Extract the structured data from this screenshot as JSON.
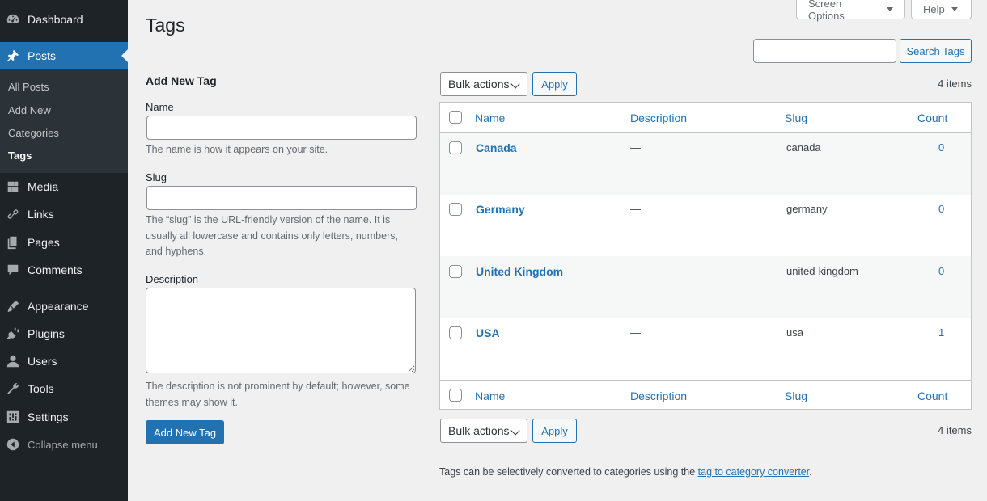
{
  "sidebar": {
    "items": [
      {
        "label": "Dashboard",
        "icon": "dashboard-icon"
      },
      {
        "label": "Posts",
        "icon": "pushpin-icon"
      },
      {
        "label": "Media",
        "icon": "media-icon"
      },
      {
        "label": "Links",
        "icon": "link-icon"
      },
      {
        "label": "Pages",
        "icon": "pages-icon"
      },
      {
        "label": "Comments",
        "icon": "comment-icon"
      },
      {
        "label": "Appearance",
        "icon": "brush-icon"
      },
      {
        "label": "Plugins",
        "icon": "plug-icon"
      },
      {
        "label": "Users",
        "icon": "user-icon"
      },
      {
        "label": "Tools",
        "icon": "wrench-icon"
      },
      {
        "label": "Settings",
        "icon": "settings-icon"
      }
    ],
    "submenu": [
      "All Posts",
      "Add New",
      "Categories",
      "Tags"
    ],
    "collapse_label": "Collapse menu",
    "colors": {
      "background": "#1d2327",
      "active": "#2271b1"
    }
  },
  "header": {
    "title": "Tags",
    "screen_options": "Screen Options",
    "help": "Help"
  },
  "form": {
    "heading": "Add New Tag",
    "name_label": "Name",
    "name_value": "",
    "name_help": "The name is how it appears on your site.",
    "slug_label": "Slug",
    "slug_value": "",
    "slug_help": "The “slug” is the URL-friendly version of the name. It is usually all lowercase and contains only letters, numbers, and hyphens.",
    "description_label": "Description",
    "description_value": "",
    "description_help": "The description is not prominent by default; however, some themes may show it.",
    "submit_label": "Add New Tag"
  },
  "search": {
    "value": "",
    "button_label": "Search Tags"
  },
  "bulk": {
    "selected": "Bulk actions",
    "apply_label": "Apply",
    "items_count": "4 items"
  },
  "table": {
    "columns": [
      "Name",
      "Description",
      "Slug",
      "Count"
    ],
    "rows": [
      {
        "name": "Canada",
        "description": "—",
        "slug": "canada",
        "count": "0"
      },
      {
        "name": "Germany",
        "description": "—",
        "slug": "germany",
        "count": "0"
      },
      {
        "name": "United Kingdom",
        "description": "—",
        "slug": "united-kingdom",
        "count": "0"
      },
      {
        "name": "USA",
        "description": "—",
        "slug": "usa",
        "count": "1"
      }
    ]
  },
  "footer": {
    "note_prefix": "Tags can be selectively converted to categories using the ",
    "link_text": "tag to category converter",
    "note_suffix": "."
  }
}
